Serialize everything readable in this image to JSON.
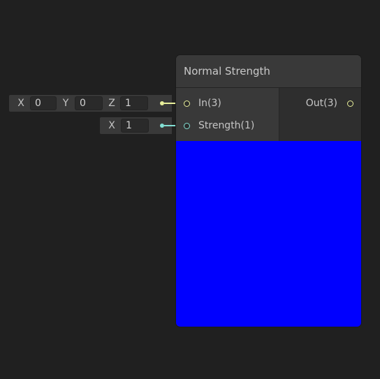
{
  "node": {
    "title": "Normal Strength",
    "inputs": [
      {
        "label": "In(3)",
        "port_color": "#e9f09b"
      },
      {
        "label": "Strength(1)",
        "port_color": "#83e0d4"
      }
    ],
    "outputs": [
      {
        "label": "Out(3)",
        "port_color": "#e9f09b"
      }
    ],
    "preview_color": "#0000ff"
  },
  "in_vector_field": {
    "x_label": "X",
    "x_value": "0",
    "y_label": "Y",
    "y_value": "0",
    "z_label": "Z",
    "z_value": "1"
  },
  "strength_field": {
    "x_label": "X",
    "x_value": "1"
  }
}
